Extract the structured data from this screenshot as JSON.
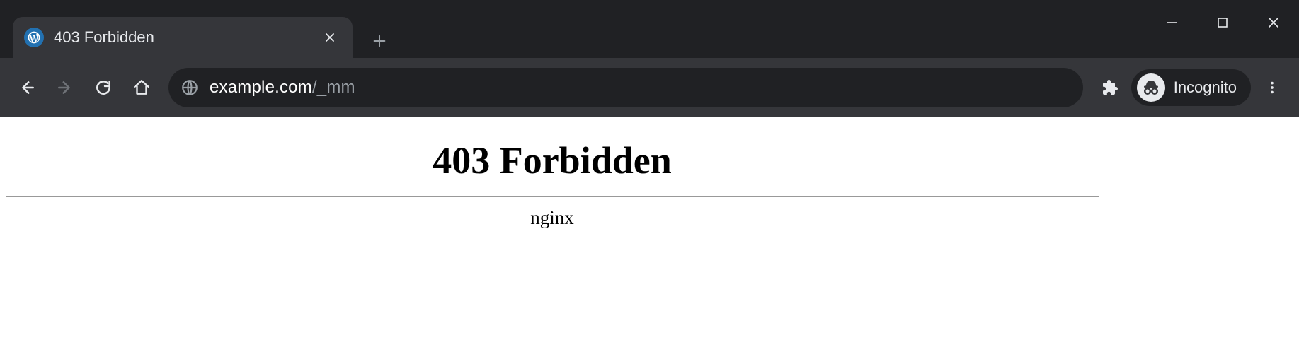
{
  "tab": {
    "title": "403 Forbidden"
  },
  "omnibox": {
    "domain": "example.com",
    "path": "/_mm"
  },
  "incognito": {
    "label": "Incognito"
  },
  "page": {
    "heading": "403 Forbidden",
    "server": "nginx"
  }
}
